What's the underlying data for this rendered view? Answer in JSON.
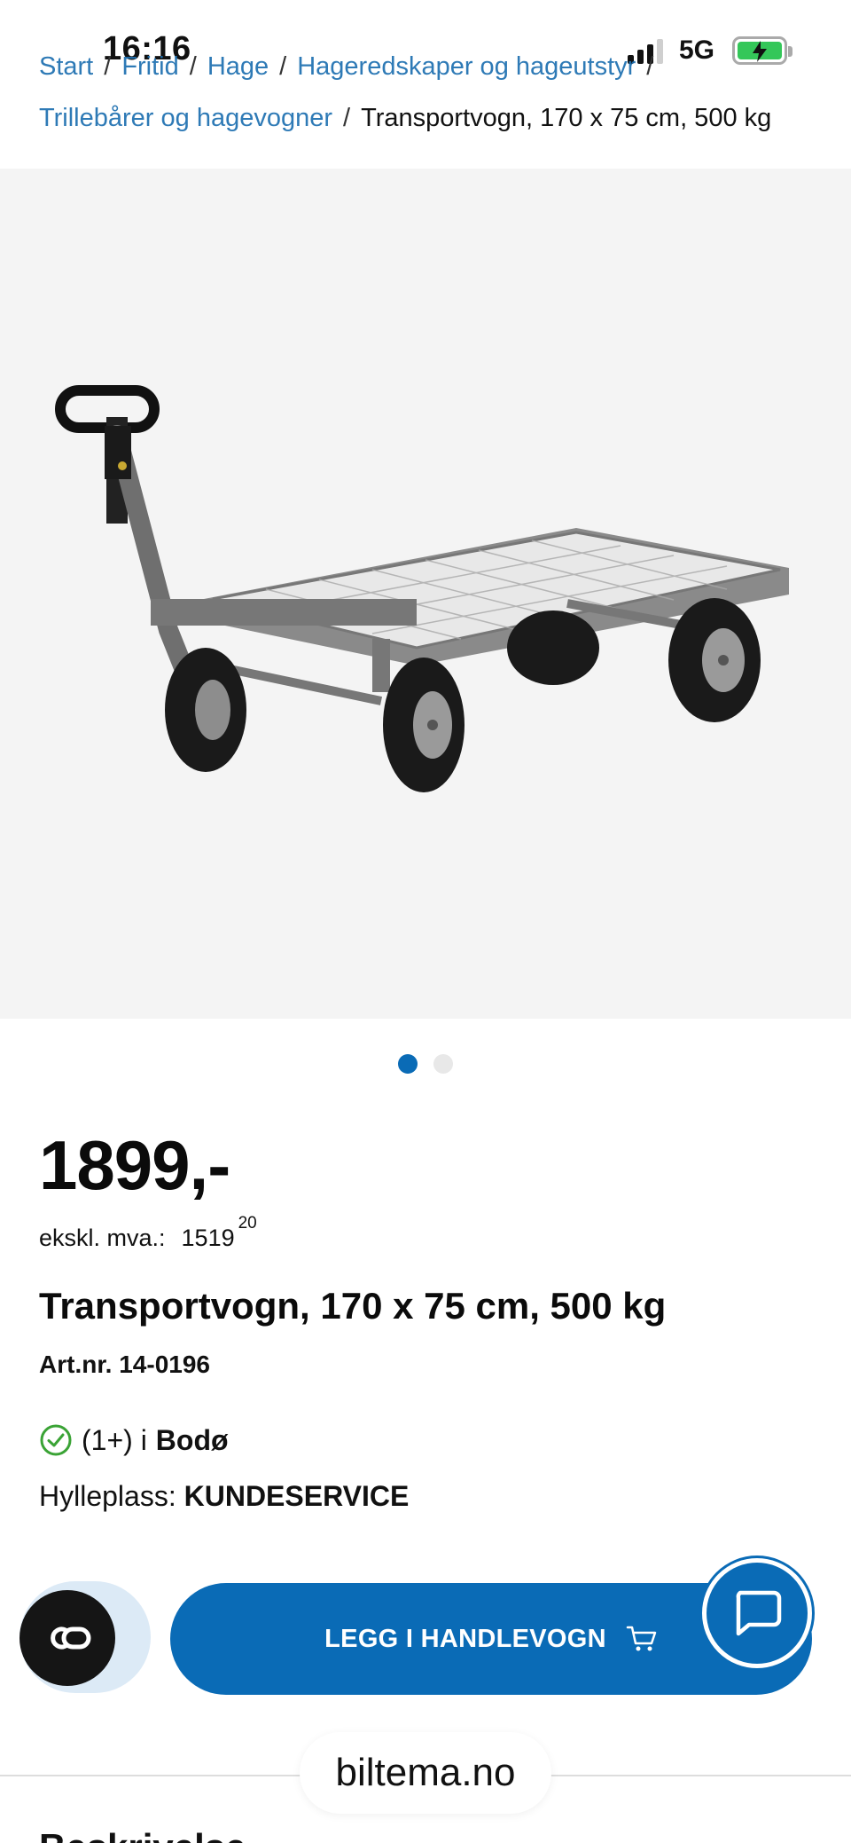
{
  "status_bar": {
    "time": "16:16",
    "network": "5G"
  },
  "breadcrumb": {
    "items": [
      "Start",
      "Fritid",
      "Hage",
      "Hageredskaper og hageutstyr",
      "Trillebårer og hagevogner"
    ],
    "current": "Transportvogn, 170 x 75 cm, 500 kg"
  },
  "gallery": {
    "count": 2,
    "active_index": 0,
    "image_icon": "transport-cart-image"
  },
  "product": {
    "price": "1899,-",
    "ex_vat_label": "ekskl. mva.:",
    "ex_vat_value": "1519",
    "ex_vat_decimals": "20",
    "title": "Transportvogn, 170 x 75 cm, 500 kg",
    "article_number": "Art.nr. 14-0196"
  },
  "stock": {
    "quantity": "(1+) i",
    "store": "Bodø",
    "icon": "check-circle-icon"
  },
  "shelf": {
    "label": "Hylleplass:",
    "value": "KUNDESERVICE"
  },
  "actions": {
    "add_to_cart_label": "LEGG I HANDLEVOGN",
    "cart_icon": "cart-icon",
    "chat_icon": "chat-icon",
    "co_icon": "co-icon"
  },
  "footer": {
    "domain": "biltema.no",
    "next_heading": "Beskrivelse"
  },
  "colors": {
    "brand_blue": "#0a6bb6",
    "check_green": "#3aa335",
    "link_blue": "#1d6fb0"
  }
}
